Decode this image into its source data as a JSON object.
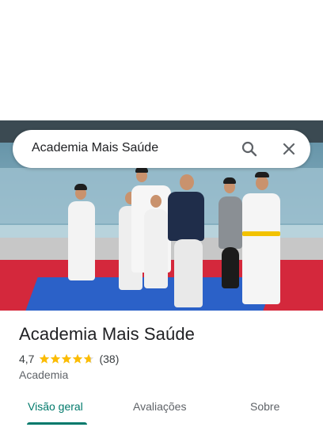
{
  "search": {
    "query": "Academia Mais Saúde"
  },
  "place": {
    "name": "Academia Mais Saúde",
    "rating": "4,7",
    "rating_value": 4.7,
    "review_count": "(38)",
    "category": "Academia"
  },
  "tabs": [
    {
      "label": "Visão geral",
      "active": true
    },
    {
      "label": "Avaliações",
      "active": false
    },
    {
      "label": "Sobre",
      "active": false
    }
  ],
  "colors": {
    "accent": "#00796b",
    "star": "#fbbc04",
    "mat_red": "#d4283c",
    "mat_blue": "#2b61c8"
  },
  "icons": {
    "search": "search-icon",
    "close": "close-icon",
    "star": "star-icon"
  }
}
